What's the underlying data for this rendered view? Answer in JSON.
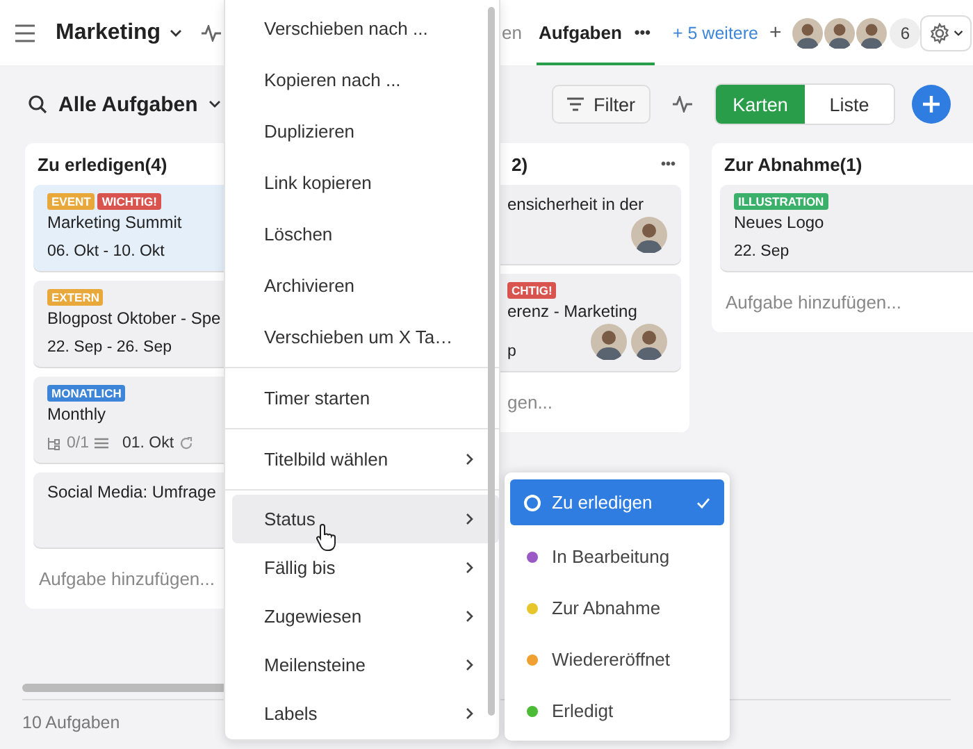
{
  "topbar": {
    "project": "Marketing",
    "tabs": [
      {
        "label": "en",
        "selected": false
      },
      {
        "label": "Aufgaben",
        "selected": true
      }
    ],
    "tab_menu": "•••",
    "more_tabs": "+ 5 weitere",
    "add_tab": "+",
    "members": [
      {
        "kind": "avatar"
      },
      {
        "kind": "avatar"
      },
      {
        "kind": "avatar"
      }
    ],
    "member_count": "6"
  },
  "toolbar": {
    "view": "Alle Aufgaben",
    "filter": "Filter",
    "views": [
      {
        "label": "Karten",
        "selected": true
      },
      {
        "label": "Liste",
        "selected": false
      }
    ]
  },
  "columns": [
    {
      "title": "Zu erledigen(4)",
      "cards": [
        {
          "labels": [
            {
              "text": "EVENT",
              "color": "#e8a83a"
            },
            {
              "text": "WICHTIG!",
              "color": "#d9534f"
            }
          ],
          "title": "Marketing Summit",
          "date": "06. Okt - 10. Okt",
          "highlighted": true
        },
        {
          "labels": [
            {
              "text": "EXTERN",
              "color": "#e8a83a"
            }
          ],
          "title": "Blogpost Oktober - Spe",
          "date": "22. Sep - 26. Sep",
          "highlighted": false
        },
        {
          "labels": [
            {
              "text": "MONATLICH",
              "color": "#3d85d8"
            }
          ],
          "title": "Monthly",
          "subtasks": "0/1",
          "due": "01. Okt",
          "highlighted": false
        },
        {
          "title": "Social Media: Umfrage",
          "highlighted": false
        }
      ],
      "add_task": "Aufgabe hinzufügen..."
    },
    {
      "title": "2)",
      "menu": "•••",
      "cards": [
        {
          "title": "ensicherheit in der",
          "assignees": [
            {
              "kind": "avatar"
            }
          ],
          "highlighted": false
        },
        {
          "labels": [
            {
              "text": "CHTIG!",
              "color": "#d9534f"
            }
          ],
          "title": "erenz - Marketing",
          "date": "p",
          "assignees": [
            {
              "kind": "avatar"
            },
            {
              "kind": "avatar"
            }
          ],
          "highlighted": false
        }
      ],
      "add_task": "gen..."
    },
    {
      "title": "Zur Abnahme(1)",
      "cards": [
        {
          "labels": [
            {
              "text": "ILLUSTRATION",
              "color": "#3bb06a"
            }
          ],
          "title": "Neues Logo",
          "date": "22. Sep",
          "highlighted": false
        }
      ],
      "add_task": "Aufgabe hinzufügen..."
    }
  ],
  "status_bar": "10 Aufgaben",
  "context_menu": {
    "groups": [
      [
        {
          "label": "Verschieben nach ...",
          "submenu": false,
          "hovered": false
        },
        {
          "label": "Kopieren nach ...",
          "submenu": false,
          "hovered": false
        },
        {
          "label": "Duplizieren",
          "submenu": false,
          "hovered": false
        },
        {
          "label": "Link kopieren",
          "submenu": false,
          "hovered": false
        },
        {
          "label": "Löschen",
          "submenu": false,
          "hovered": false
        },
        {
          "label": "Archivieren",
          "submenu": false,
          "hovered": false
        },
        {
          "label": "Verschieben um X Ta…",
          "submenu": false,
          "hovered": false
        }
      ],
      [
        {
          "label": "Timer starten",
          "submenu": false,
          "hovered": false
        }
      ],
      [
        {
          "label": "Titelbild wählen",
          "submenu": true,
          "hovered": false
        }
      ],
      [
        {
          "label": "Status",
          "submenu": true,
          "hovered": true
        },
        {
          "label": "Fällig bis",
          "submenu": true,
          "hovered": false
        },
        {
          "label": "Zugewiesen",
          "submenu": true,
          "hovered": false
        },
        {
          "label": "Meilensteine",
          "submenu": true,
          "hovered": false
        },
        {
          "label": "Labels",
          "submenu": true,
          "hovered": false
        }
      ]
    ]
  },
  "status_menu": {
    "items": [
      {
        "label": "Zu erledigen",
        "color": "#2f7de1",
        "selected": true
      },
      {
        "label": "In Bearbeitung",
        "color": "#9b59c6",
        "selected": false
      },
      {
        "label": "Zur Abnahme",
        "color": "#e6c62a",
        "selected": false
      },
      {
        "label": "Wiedereröffnet",
        "color": "#f0a030",
        "selected": false
      },
      {
        "label": "Erledigt",
        "color": "#4cbb35",
        "selected": false
      }
    ]
  }
}
